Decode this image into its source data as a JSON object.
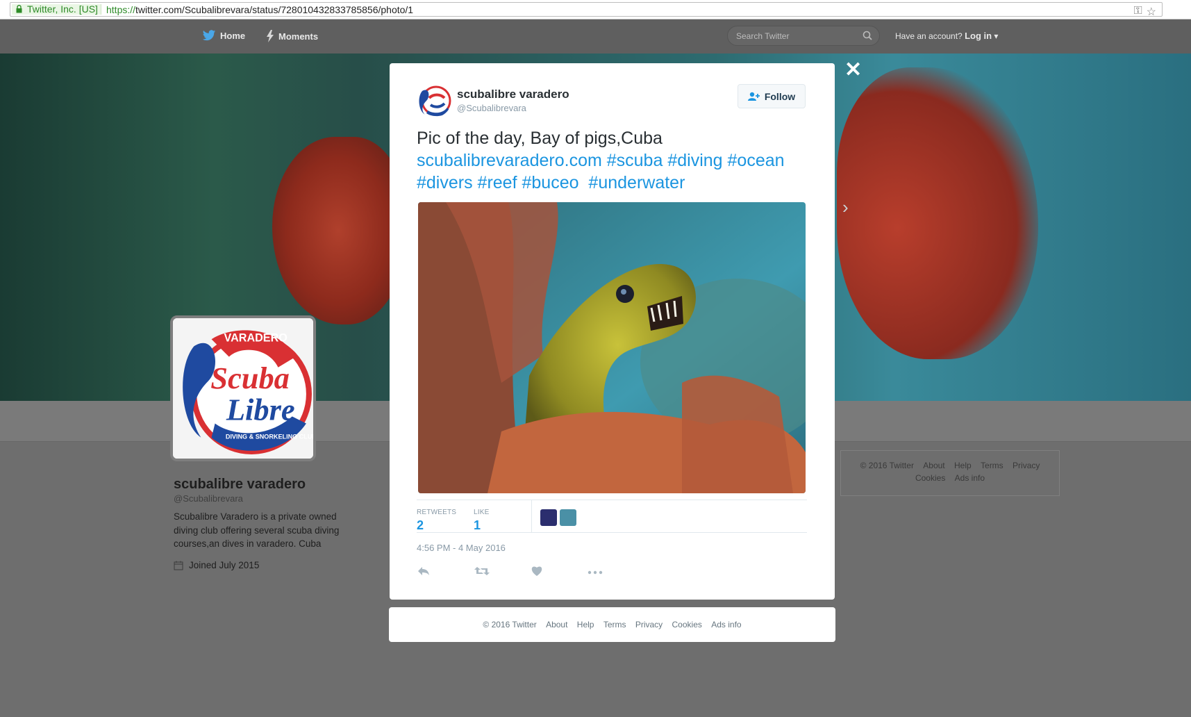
{
  "browser": {
    "ev_label": "Twitter, Inc. [US]",
    "url_proto": "https://",
    "url_rest": "twitter.com/Scubalibrevara/status/728010432833785856/photo/1"
  },
  "nav": {
    "home_label": "Home",
    "moments_label": "Moments",
    "search_placeholder": "Search Twitter",
    "have_account": "Have an account?",
    "login_label": "Log in"
  },
  "profile": {
    "name": "scubalibre varadero",
    "handle": "@Scubalibrevara",
    "bio": "Scubalibre Varadero is a private owned diving club offering several scuba diving courses,an dives in varadero. Cuba",
    "joined": "Joined July 2015",
    "logo_text": {
      "top": "VARADERO",
      "main1": "Scuba",
      "main2": "Libre",
      "ring": "DIVING & SNORKELING CLUB"
    }
  },
  "side_footer": {
    "row1": [
      "© 2016 Twitter",
      "About",
      "Help",
      "Terms",
      "Privacy"
    ],
    "row2": [
      "Cookies",
      "Ads info"
    ]
  },
  "tweet": {
    "name": "scubalibre varadero",
    "handle": "@Scubalibrevara",
    "follow_label": "Follow",
    "text_plain": "Pic of the day, Bay of pigs,Cuba",
    "link": "scubalibrevaradero.com",
    "hashtags_line1": [
      "#scuba",
      "#diving",
      "#ocean"
    ],
    "hashtags_line2": [
      "#divers",
      "#reef",
      "#buceo",
      "#underwater"
    ],
    "retweets_label": "RETWEETS",
    "retweets_count": "2",
    "likes_label": "LIKE",
    "likes_count": "1",
    "timestamp": "4:56 PM - 4 May 2016"
  },
  "modal_footer": [
    "© 2016 Twitter",
    "About",
    "Help",
    "Terms",
    "Privacy",
    "Cookies",
    "Ads info"
  ],
  "colors": {
    "link_blue": "#1b95e0",
    "ev_green": "#2d8a27",
    "overlay_gray": "#6e6e6e"
  },
  "icons": [
    "lock-icon",
    "key-icon",
    "star-icon",
    "twitter-bird-icon",
    "lightning-icon",
    "search-icon",
    "close-icon",
    "chevron-right-icon",
    "follow-person-icon",
    "calendar-icon",
    "reply-icon",
    "retweet-icon",
    "heart-icon",
    "more-icon"
  ]
}
